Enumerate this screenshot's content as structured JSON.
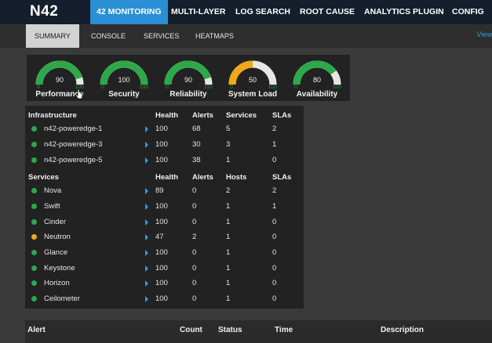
{
  "app": {
    "logo": "N42"
  },
  "nav": {
    "items": [
      {
        "label": "42 MONITORING",
        "active": true
      },
      {
        "label": "MULTI-LAYER"
      },
      {
        "label": "LOG SEARCH"
      },
      {
        "label": "ROOT CAUSE"
      },
      {
        "label": "ANALYTICS PLUGIN"
      },
      {
        "label": "CONFIG"
      }
    ]
  },
  "subnav": {
    "items": [
      {
        "label": "SUMMARY",
        "active": true
      },
      {
        "label": "CONSOLE"
      },
      {
        "label": "SERVICES"
      },
      {
        "label": "HEATMAPS"
      }
    ],
    "view_link": "View"
  },
  "gauges": [
    {
      "label": "Performance",
      "value": 90,
      "min": "0",
      "max": "100",
      "color": "#2ea84a"
    },
    {
      "label": "Security",
      "value": 100,
      "min": "0",
      "max": "100",
      "color": "#2ea84a"
    },
    {
      "label": "Reliability",
      "value": 90,
      "min": "0",
      "max": "100",
      "color": "#2ea84a"
    },
    {
      "label": "System Load",
      "value": 50,
      "min": "0",
      "max": "100",
      "color": "#f0a818"
    },
    {
      "label": "Availability",
      "value": 80,
      "min": "0",
      "max": "100",
      "color": "#2ea84a"
    }
  ],
  "infrastructure": {
    "headers": [
      "Infrastructure",
      "Health",
      "Alerts",
      "Services",
      "SLAs"
    ],
    "rows": [
      {
        "name": "n42-poweredge-1",
        "health": "100",
        "alerts": "68",
        "count": "5",
        "slas": "2",
        "status": "#2ea84a"
      },
      {
        "name": "n42-poweredge-3",
        "health": "100",
        "alerts": "30",
        "count": "3",
        "slas": "1",
        "status": "#2ea84a"
      },
      {
        "name": "n42-poweredge-5",
        "health": "100",
        "alerts": "38",
        "count": "1",
        "slas": "0",
        "status": "#2ea84a"
      }
    ]
  },
  "services": {
    "headers": [
      "Services",
      "Health",
      "Alerts",
      "Hosts",
      "SLAs"
    ],
    "rows": [
      {
        "name": "Nova",
        "health": "89",
        "alerts": "0",
        "count": "2",
        "slas": "2",
        "status": "#2ea84a"
      },
      {
        "name": "Swift",
        "health": "100",
        "alerts": "0",
        "count": "1",
        "slas": "1",
        "status": "#2ea84a"
      },
      {
        "name": "Cinder",
        "health": "100",
        "alerts": "0",
        "count": "1",
        "slas": "0",
        "status": "#2ea84a"
      },
      {
        "name": "Neutron",
        "health": "47",
        "alerts": "2",
        "count": "1",
        "slas": "0",
        "status": "#f0a818"
      },
      {
        "name": "Glance",
        "health": "100",
        "alerts": "0",
        "count": "1",
        "slas": "0",
        "status": "#2ea84a"
      },
      {
        "name": "Keystone",
        "health": "100",
        "alerts": "0",
        "count": "1",
        "slas": "0",
        "status": "#2ea84a"
      },
      {
        "name": "Horizon",
        "health": "100",
        "alerts": "0",
        "count": "1",
        "slas": "0",
        "status": "#2ea84a"
      },
      {
        "name": "Ceilometer",
        "health": "100",
        "alerts": "0",
        "count": "1",
        "slas": "0",
        "status": "#2ea84a"
      }
    ]
  },
  "alerts_table": {
    "headers": [
      "Alert",
      "Count",
      "Status",
      "Time",
      "Description"
    ]
  }
}
